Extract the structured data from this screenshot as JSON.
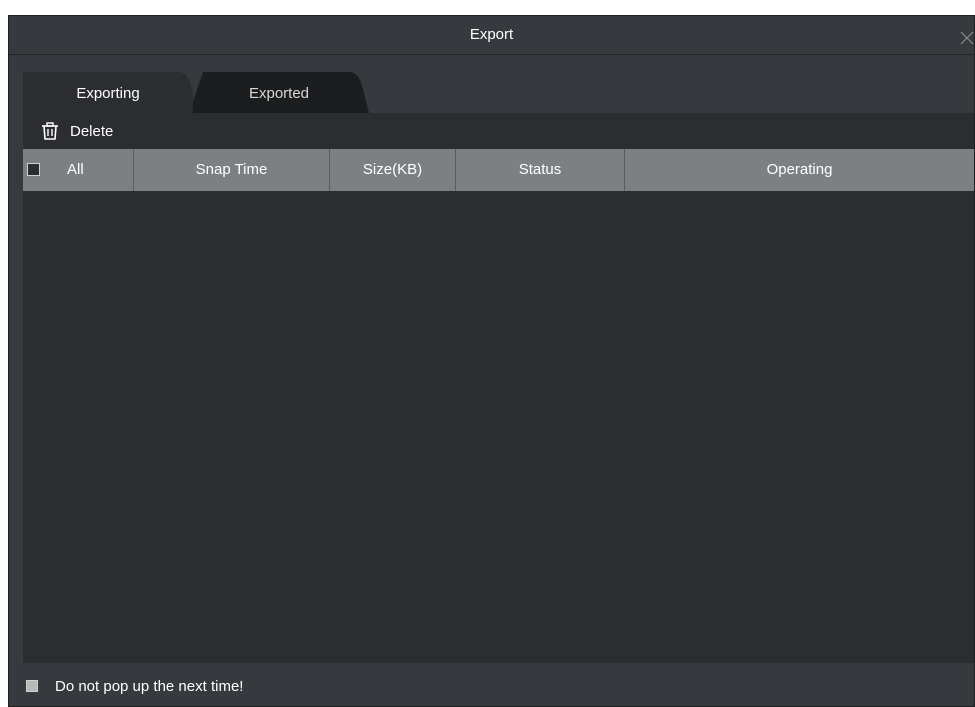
{
  "dialog": {
    "title": "Export"
  },
  "tabs": [
    {
      "label": "Exporting",
      "active": true
    },
    {
      "label": "Exported",
      "active": false
    }
  ],
  "toolbar": {
    "delete_label": "Delete",
    "delete_icon": "trash-icon"
  },
  "table": {
    "columns": [
      "All",
      "Snap Time",
      "Size(KB)",
      "Status",
      "Operating"
    ],
    "rows": []
  },
  "footer": {
    "checkbox_label": "Do not pop up the next time!"
  },
  "colors": {
    "dialog_bg": "#36393d",
    "content_bg": "#2b2d31",
    "header_bg": "#7c8083",
    "inactive_tab_bg": "#1e1f21"
  }
}
